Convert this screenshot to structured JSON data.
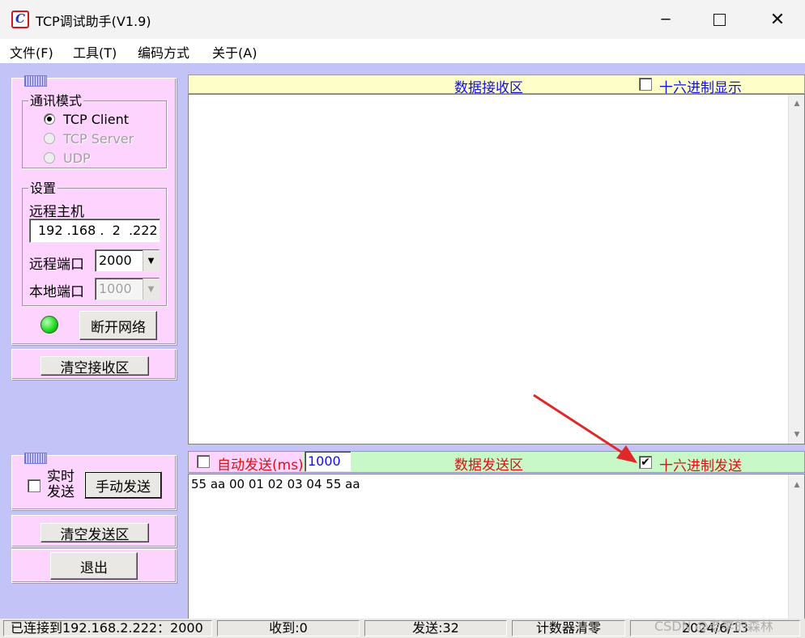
{
  "window": {
    "title": "TCP调试助手(V1.9)",
    "controls": [
      "minimize",
      "maximize",
      "close"
    ]
  },
  "menu": [
    "文件(F)",
    "工具(T)",
    "编码方式",
    "关于(A)"
  ],
  "comm_mode": {
    "title": "通讯模式",
    "options": [
      {
        "label": "TCP Client",
        "selected": true,
        "enabled": true
      },
      {
        "label": "TCP Server",
        "selected": false,
        "enabled": false
      },
      {
        "label": "UDP",
        "selected": false,
        "enabled": false
      }
    ]
  },
  "settings": {
    "title": "设置",
    "remote_host_label": "远程主机",
    "remote_host_value": "192 .168 .  2  .222",
    "remote_port_label": "远程端口",
    "remote_port_value": "2000",
    "local_port_label": "本地端口",
    "local_port_value": "1000"
  },
  "connection": {
    "status_color": "#22dd22",
    "disconnect_label": "断开网络"
  },
  "clear_recv_label": "清空接收区",
  "send_panel": {
    "realtime_label_1": "实时",
    "realtime_label_2": "发送",
    "realtime_checked": false,
    "manual_send_label": "手动发送",
    "clear_send_label": "清空发送区",
    "exit_label": "退出"
  },
  "recv_area": {
    "title": "数据接收区",
    "hex_display_label": "十六进制显示",
    "hex_display_checked": false,
    "content": ""
  },
  "send_area": {
    "auto_send_label": "自动发送(ms)",
    "auto_send_checked": false,
    "interval": "1000",
    "title": "数据发送区",
    "hex_send_label": "十六进制发送",
    "hex_send_checked": true,
    "content": "55 aa 00 01 02 03 04 55 aa"
  },
  "status": {
    "connected": "已连接到192.168.2.222：2000",
    "received": "收到:0",
    "sent": "发送:32",
    "reset_counter": "计数器清零",
    "date": "2024/6/13"
  },
  "watermark": "CSDN @老李的森林",
  "colors": {
    "client_bg": "#c3c3f8",
    "panel_bg": "#fdd4fd",
    "recv_header_bg": "#fefec8",
    "send_header_bg": "#c8f8c8",
    "label_blue": "#1010e0",
    "label_red": "#e01010",
    "annotation_arrow": "#e02828"
  }
}
